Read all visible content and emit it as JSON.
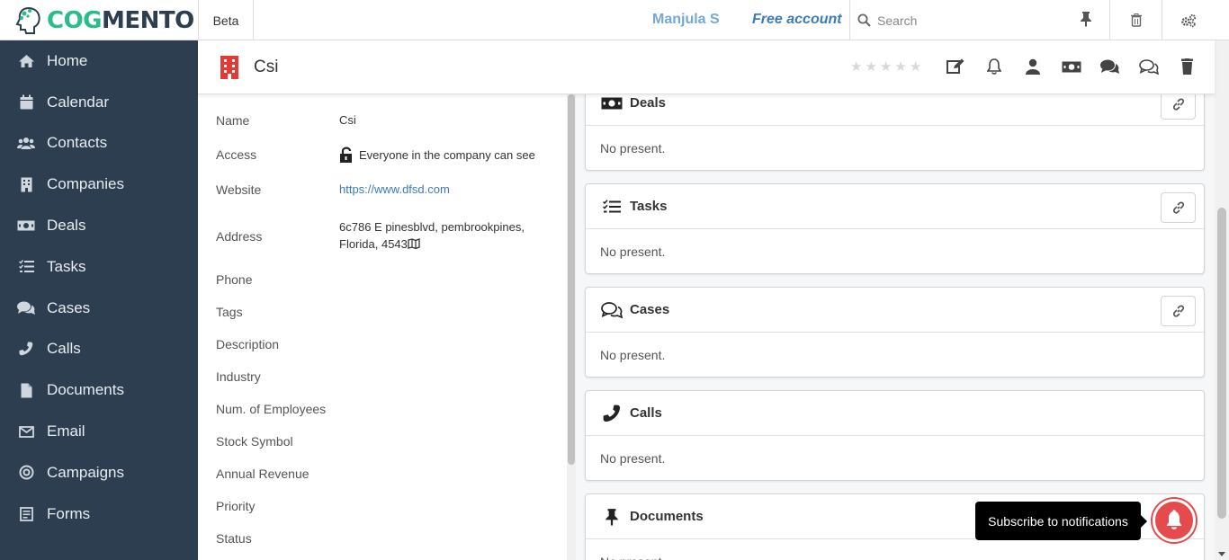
{
  "app": {
    "logo_part1": "COG",
    "logo_part2": "MENTO",
    "beta_label": "Beta",
    "username": "Manjula S",
    "account_type": "Free account",
    "search_placeholder": "Search"
  },
  "sidebar": {
    "items": [
      {
        "label": "Home",
        "icon": "home-icon"
      },
      {
        "label": "Calendar",
        "icon": "calendar-icon"
      },
      {
        "label": "Contacts",
        "icon": "contacts-icon"
      },
      {
        "label": "Companies",
        "icon": "building-icon"
      },
      {
        "label": "Deals",
        "icon": "money-icon"
      },
      {
        "label": "Tasks",
        "icon": "tasks-icon"
      },
      {
        "label": "Cases",
        "icon": "comments-icon"
      },
      {
        "label": "Calls",
        "icon": "phone-icon"
      },
      {
        "label": "Documents",
        "icon": "file-icon"
      },
      {
        "label": "Email",
        "icon": "envelope-icon"
      },
      {
        "label": "Campaigns",
        "icon": "bullseye-icon"
      },
      {
        "label": "Forms",
        "icon": "form-icon"
      }
    ]
  },
  "record": {
    "title": "Csi",
    "rating": 0,
    "rating_max": 5
  },
  "details": {
    "fields": [
      {
        "label": "Name",
        "value": "Csi"
      },
      {
        "label": "Access",
        "value": "Everyone in the company can see"
      },
      {
        "label": "Website",
        "value": "https://www.dfsd.com"
      },
      {
        "label": "Address",
        "value": "6c786 E pinesblvd, pembrookpines, Florida, 4543"
      },
      {
        "label": "Phone",
        "value": ""
      },
      {
        "label": "Tags",
        "value": ""
      },
      {
        "label": "Description",
        "value": ""
      },
      {
        "label": "Industry",
        "value": ""
      },
      {
        "label": "Num. of Employees",
        "value": ""
      },
      {
        "label": "Stock Symbol",
        "value": ""
      },
      {
        "label": "Annual Revenue",
        "value": ""
      },
      {
        "label": "Priority",
        "value": ""
      },
      {
        "label": "Status",
        "value": ""
      }
    ]
  },
  "cards": [
    {
      "title": "Deals",
      "body": "No present."
    },
    {
      "title": "Tasks",
      "body": "No present."
    },
    {
      "title": "Cases",
      "body": "No present."
    },
    {
      "title": "Calls",
      "body": "No present."
    },
    {
      "title": "Documents",
      "body": "No present."
    }
  ],
  "notification": {
    "label": "Subscribe to notifications"
  },
  "colors": {
    "sidebar_bg": "#2d3e50",
    "brand_green": "#2bbb8d",
    "link_blue": "#3a7bbd",
    "notify_red": "#e54b4d"
  }
}
